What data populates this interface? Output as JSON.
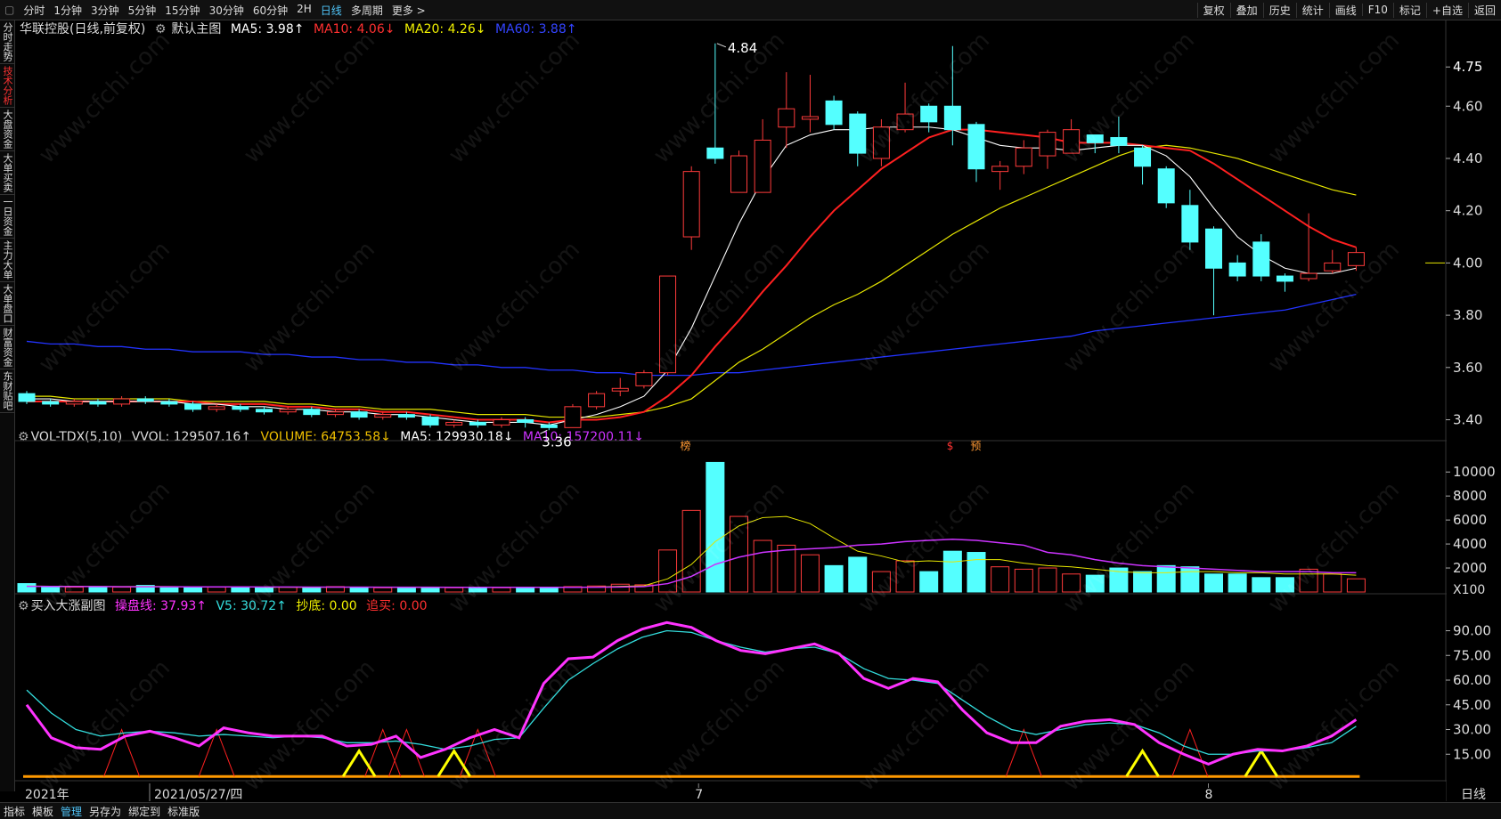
{
  "toolbar": {
    "left": [
      "分时",
      "1分钟",
      "3分钟",
      "5分钟",
      "15分钟",
      "30分钟",
      "60分钟",
      "2H",
      "日线",
      "多周期",
      "更多 >"
    ],
    "active": "日线",
    "right": [
      "复权",
      "叠加",
      "历史",
      "统计",
      "画线",
      "F10",
      "标记",
      "+自选",
      "返回"
    ]
  },
  "sidebar": [
    "分时走势",
    "技术分析",
    "大盘资金",
    "大单买卖",
    "一日资金",
    "主力大单",
    "大单盘口",
    "财富资金",
    "东财贴吧"
  ],
  "sidebar_active": "技术分析",
  "main_legend": {
    "stock": "华联控股(日线,前复权)",
    "label": "默认主图",
    "ma5": "MA5: 3.98↑",
    "ma10": "MA10: 4.06↓",
    "ma20": "MA20: 4.26↓",
    "ma60": "MA60: 3.88↑"
  },
  "vol_legend": {
    "name": "VOL-TDX(5,10)",
    "vvol": "VVOL: 129507.16↑",
    "volume": "VOLUME: 64753.58↓",
    "ma5": "MA5: 129930.18↓",
    "ma10": "MA10: 157200.11↓"
  },
  "ind_legend": {
    "name": "买入大涨副图",
    "czx": "操盘线: 37.93↑",
    "v5": "V5: 30.72↑",
    "cd": "抄底: 0.00",
    "zm": "追买: 0.00"
  },
  "price_axis": [
    "4.75",
    "4.60",
    "4.40",
    "4.20",
    "4.00",
    "3.80",
    "3.60",
    "3.40"
  ],
  "vol_axis": [
    "10000",
    "8000",
    "6000",
    "4000",
    "2000",
    "X100"
  ],
  "ind_axis": [
    "90.00",
    "75.00",
    "60.00",
    "45.00",
    "30.00",
    "15.00"
  ],
  "date_axis": {
    "d1": "2021年",
    "d2": "2021/05/27/四",
    "d3": "7",
    "d4": "8",
    "tail": "日线"
  },
  "markers": {
    "high": "4.84",
    "low": "3.36",
    "m1": "榜",
    "m2": "$",
    "m3": "预"
  },
  "bottom": [
    "指标",
    "模板",
    "管理",
    "另存为",
    "绑定到",
    "标准版"
  ],
  "bottom_active": "管理",
  "watermark": "www.cfchi.com",
  "colors": {
    "up": "#ff3b3b",
    "down": "#54ffff",
    "ma5": "#ffffff",
    "ma10": "#ff2020",
    "ma20": "#e6e600",
    "ma60": "#2233ff",
    "czx": "#ff33ff",
    "v5": "#33dddd",
    "cd": "#ffff00",
    "zm": "#ff2020"
  },
  "chart_data": {
    "type": "candlestick",
    "candles": [
      [
        3.5,
        3.47,
        3.51,
        3.46
      ],
      [
        3.47,
        3.46,
        3.48,
        3.45
      ],
      [
        3.46,
        3.47,
        3.48,
        3.45
      ],
      [
        3.47,
        3.46,
        3.48,
        3.45
      ],
      [
        3.46,
        3.48,
        3.49,
        3.45
      ],
      [
        3.48,
        3.47,
        3.49,
        3.46
      ],
      [
        3.47,
        3.46,
        3.48,
        3.45
      ],
      [
        3.46,
        3.44,
        3.47,
        3.43
      ],
      [
        3.44,
        3.45,
        3.46,
        3.43
      ],
      [
        3.45,
        3.44,
        3.46,
        3.43
      ],
      [
        3.44,
        3.43,
        3.45,
        3.42
      ],
      [
        3.43,
        3.44,
        3.45,
        3.42
      ],
      [
        3.44,
        3.42,
        3.45,
        3.41
      ],
      [
        3.42,
        3.43,
        3.44,
        3.41
      ],
      [
        3.43,
        3.41,
        3.44,
        3.4
      ],
      [
        3.41,
        3.42,
        3.43,
        3.4
      ],
      [
        3.42,
        3.41,
        3.43,
        3.4
      ],
      [
        3.41,
        3.38,
        3.42,
        3.37
      ],
      [
        3.38,
        3.39,
        3.4,
        3.37
      ],
      [
        3.39,
        3.38,
        3.4,
        3.37
      ],
      [
        3.38,
        3.4,
        3.41,
        3.37
      ],
      [
        3.4,
        3.39,
        3.41,
        3.37
      ],
      [
        3.38,
        3.37,
        3.39,
        3.36
      ],
      [
        3.37,
        3.45,
        3.46,
        3.37
      ],
      [
        3.45,
        3.5,
        3.51,
        3.44
      ],
      [
        3.51,
        3.52,
        3.56,
        3.49
      ],
      [
        3.53,
        3.58,
        3.59,
        3.52
      ],
      [
        3.58,
        3.95,
        3.95,
        3.57
      ],
      [
        4.1,
        4.35,
        4.37,
        4.05
      ],
      [
        4.44,
        4.4,
        4.84,
        4.38
      ],
      [
        4.27,
        4.41,
        4.43,
        4.27
      ],
      [
        4.27,
        4.47,
        4.55,
        4.27
      ],
      [
        4.52,
        4.59,
        4.73,
        4.44
      ],
      [
        4.55,
        4.56,
        4.72,
        4.5
      ],
      [
        4.62,
        4.53,
        4.64,
        4.51
      ],
      [
        4.57,
        4.42,
        4.58,
        4.37
      ],
      [
        4.4,
        4.52,
        4.55,
        4.37
      ],
      [
        4.51,
        4.57,
        4.69,
        4.5
      ],
      [
        4.6,
        4.54,
        4.61,
        4.5
      ],
      [
        4.6,
        4.51,
        4.83,
        4.45
      ],
      [
        4.53,
        4.36,
        4.54,
        4.31
      ],
      [
        4.35,
        4.37,
        4.39,
        4.28
      ],
      [
        4.37,
        4.44,
        4.47,
        4.34
      ],
      [
        4.41,
        4.5,
        4.51,
        4.36
      ],
      [
        4.42,
        4.51,
        4.55,
        4.42
      ],
      [
        4.49,
        4.46,
        4.49,
        4.42
      ],
      [
        4.48,
        4.45,
        4.56,
        4.42
      ],
      [
        4.44,
        4.37,
        4.45,
        4.3
      ],
      [
        4.36,
        4.23,
        4.37,
        4.21
      ],
      [
        4.22,
        4.08,
        4.28,
        4.05
      ],
      [
        4.13,
        3.98,
        4.14,
        3.8
      ],
      [
        4.0,
        3.95,
        4.03,
        3.93
      ],
      [
        4.08,
        3.95,
        4.11,
        3.93
      ],
      [
        3.95,
        3.93,
        3.96,
        3.89
      ],
      [
        3.94,
        3.96,
        4.19,
        3.93
      ],
      [
        3.97,
        4.0,
        4.05,
        3.96
      ],
      [
        3.99,
        4.04,
        4.06,
        3.97
      ]
    ],
    "ma5": [
      3.48,
      3.48,
      3.47,
      3.47,
      3.47,
      3.47,
      3.47,
      3.46,
      3.46,
      3.45,
      3.45,
      3.44,
      3.44,
      3.43,
      3.43,
      3.42,
      3.42,
      3.41,
      3.4,
      3.39,
      3.39,
      3.39,
      3.38,
      3.4,
      3.42,
      3.45,
      3.49,
      3.59,
      3.75,
      3.95,
      4.15,
      4.32,
      4.45,
      4.49,
      4.51,
      4.51,
      4.52,
      4.52,
      4.52,
      4.51,
      4.48,
      4.45,
      4.44,
      4.44,
      4.43,
      4.44,
      4.45,
      4.45,
      4.41,
      4.33,
      4.21,
      4.1,
      4.03,
      3.98,
      3.96,
      3.96,
      3.98
    ],
    "ma10": [
      3.47,
      3.47,
      3.47,
      3.47,
      3.47,
      3.47,
      3.47,
      3.47,
      3.46,
      3.46,
      3.46,
      3.45,
      3.45,
      3.44,
      3.44,
      3.43,
      3.43,
      3.42,
      3.41,
      3.4,
      3.4,
      3.4,
      3.39,
      3.4,
      3.4,
      3.41,
      3.43,
      3.49,
      3.57,
      3.68,
      3.78,
      3.89,
      3.99,
      4.1,
      4.2,
      4.28,
      4.36,
      4.42,
      4.48,
      4.51,
      4.51,
      4.5,
      4.49,
      4.48,
      4.46,
      4.46,
      4.46,
      4.45,
      4.44,
      4.43,
      4.38,
      4.32,
      4.26,
      4.2,
      4.14,
      4.09,
      4.06
    ],
    "ma20": [
      3.49,
      3.49,
      3.48,
      3.48,
      3.48,
      3.48,
      3.48,
      3.47,
      3.47,
      3.47,
      3.47,
      3.46,
      3.46,
      3.45,
      3.45,
      3.44,
      3.44,
      3.44,
      3.43,
      3.42,
      3.42,
      3.42,
      3.41,
      3.41,
      3.41,
      3.42,
      3.43,
      3.45,
      3.48,
      3.55,
      3.62,
      3.67,
      3.73,
      3.79,
      3.84,
      3.88,
      3.93,
      3.99,
      4.05,
      4.11,
      4.16,
      4.21,
      4.25,
      4.29,
      4.33,
      4.37,
      4.41,
      4.44,
      4.45,
      4.44,
      4.42,
      4.4,
      4.37,
      4.34,
      4.31,
      4.28,
      4.26
    ],
    "ma60": [
      3.7,
      3.69,
      3.69,
      3.68,
      3.68,
      3.67,
      3.67,
      3.66,
      3.66,
      3.66,
      3.65,
      3.65,
      3.64,
      3.64,
      3.63,
      3.63,
      3.62,
      3.62,
      3.61,
      3.61,
      3.6,
      3.6,
      3.59,
      3.59,
      3.58,
      3.58,
      3.57,
      3.57,
      3.57,
      3.58,
      3.58,
      3.59,
      3.6,
      3.61,
      3.62,
      3.63,
      3.64,
      3.65,
      3.66,
      3.67,
      3.68,
      3.69,
      3.7,
      3.71,
      3.72,
      3.74,
      3.75,
      3.76,
      3.77,
      3.78,
      3.79,
      3.8,
      3.81,
      3.82,
      3.84,
      3.86,
      3.88
    ],
    "volume": [
      700,
      400,
      400,
      400,
      400,
      550,
      350,
      400,
      400,
      350,
      350,
      400,
      400,
      450,
      400,
      350,
      350,
      400,
      350,
      400,
      350,
      350,
      400,
      450,
      500,
      650,
      600,
      3500,
      6800,
      10800,
      6300,
      4300,
      3900,
      3100,
      2200,
      2900,
      1700,
      2600,
      1700,
      3400,
      3300,
      2100,
      1900,
      2000,
      1500,
      1400,
      2000,
      1700,
      2200,
      2100,
      1500,
      1500,
      1200,
      1200,
      1900,
      1500,
      1100
    ],
    "vol_ma5": [
      500,
      480,
      470,
      460,
      450,
      460,
      450,
      440,
      430,
      420,
      400,
      390,
      390,
      400,
      410,
      400,
      390,
      380,
      380,
      380,
      380,
      380,
      380,
      400,
      420,
      470,
      520,
      1100,
      2300,
      4200,
      5500,
      6200,
      6300,
      5700,
      4500,
      3400,
      3000,
      2500,
      2600,
      2500,
      2700,
      2700,
      2400,
      2200,
      2100,
      1900,
      1700,
      1600,
      1600,
      1700,
      1700,
      1600,
      1600,
      1500,
      1500,
      1500,
      1400
    ],
    "vol_ma10": [
      470,
      460,
      450,
      450,
      440,
      440,
      440,
      430,
      430,
      430,
      420,
      420,
      410,
      410,
      410,
      400,
      400,
      400,
      390,
      390,
      390,
      390,
      390,
      390,
      400,
      420,
      450,
      700,
      1300,
      2300,
      2900,
      3300,
      3500,
      3600,
      3700,
      3900,
      4000,
      4200,
      4300,
      4400,
      4300,
      4100,
      3900,
      3300,
      3100,
      2700,
      2400,
      2200,
      2100,
      2000,
      1900,
      1800,
      1700,
      1700,
      1700,
      1600,
      1600
    ],
    "czx": [
      45,
      25,
      19,
      18,
      26,
      29,
      25,
      20,
      31,
      28,
      26,
      26,
      26,
      20,
      21,
      26,
      13,
      18,
      25,
      30,
      25,
      58,
      73,
      74,
      84,
      91,
      95,
      92,
      84,
      78,
      76,
      79,
      82,
      76,
      61,
      55,
      61,
      59,
      42,
      28,
      22,
      22,
      32,
      35,
      36,
      33,
      22,
      15,
      9,
      15,
      18,
      17,
      20,
      26,
      36
    ],
    "v5": [
      54,
      40,
      30,
      26,
      28,
      29,
      28,
      26,
      27,
      26,
      25,
      26,
      25,
      22,
      22,
      23,
      21,
      18,
      20,
      24,
      25,
      43,
      60,
      70,
      79,
      86,
      90,
      89,
      84,
      80,
      77,
      79,
      80,
      76,
      67,
      61,
      60,
      58,
      48,
      38,
      30,
      27,
      30,
      33,
      34,
      33,
      28,
      20,
      15,
      15,
      17,
      17,
      19,
      22,
      32
    ],
    "czx_labels": {
      "czx": "操盘线",
      "v5": "V5"
    }
  }
}
